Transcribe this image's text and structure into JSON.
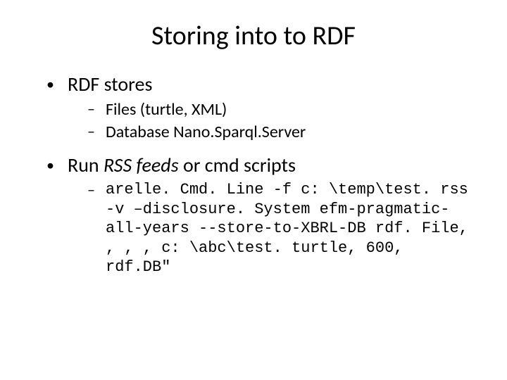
{
  "title": "Storing into to RDF",
  "items": [
    {
      "label": "RDF stores",
      "sub": [
        "Files (turtle, XML)",
        "Database Nano.Sparql.Server"
      ]
    },
    {
      "label_pre": "Run ",
      "label_em": "RSS feeds",
      "label_post": " or cmd scripts",
      "code": [
        "arelle. Cmd. Line -f c: \\temp\\test. rss -v –disclosure. System efm-pragmatic-all-years --store-to-XBRL-DB rdf. File, , , , c: \\abc\\test. turtle, 600, rdf.DB\""
      ]
    }
  ]
}
